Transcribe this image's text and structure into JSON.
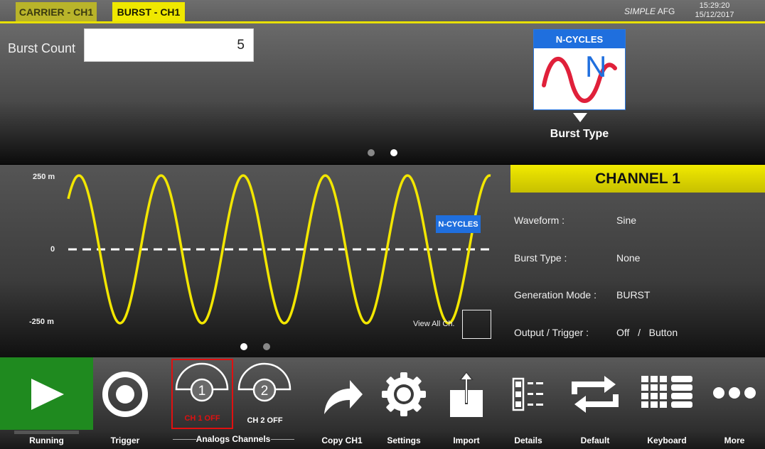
{
  "header": {
    "tab_carrier": "CARRIER - CH1",
    "tab_burst": "BURST - CH1",
    "brand_italic": "SIMPLE",
    "brand_rest": "AFG",
    "time": "15:29:20",
    "date": "15/12/2017"
  },
  "burst": {
    "count_label": "Burst Count",
    "count_value": "5",
    "type_badge": "N-CYCLES",
    "type_letter": "N",
    "type_caption": "Burst Type",
    "page_count": 2,
    "page_active": 2
  },
  "waveform": {
    "y_top_label": "250 m",
    "y_mid_label": "0",
    "y_bottom_label": "-250 m",
    "badge": "N-CYCLES",
    "view_all_label": "View All Ch.",
    "cycles": 5,
    "page_count": 2,
    "page_active": 1
  },
  "channel": {
    "title": "CHANNEL 1",
    "rows": [
      {
        "label": "Waveform :",
        "value": "Sine"
      },
      {
        "label": "Burst Type :",
        "value": "None"
      },
      {
        "label": "Generation Mode :",
        "value": "BURST"
      },
      {
        "label": "Output / Trigger :",
        "value": "Off   /   Button"
      }
    ]
  },
  "toolbar": {
    "running": "Running",
    "trigger": "Trigger",
    "ch1_num": "1",
    "ch1_state": "CH 1 OFF",
    "ch2_num": "2",
    "ch2_state": "CH 2 OFF",
    "analogs": "Analogs Channels",
    "copy": "Copy CH1",
    "settings": "Settings",
    "import": "Import",
    "details": "Details",
    "default": "Default",
    "keyboard": "Keyboard",
    "more": "More"
  },
  "colors": {
    "accent_yellow": "#efe800",
    "badge_blue": "#1f6fde",
    "running_green": "#1f8a1f",
    "wave_yellow": "#f2e600",
    "sine_red": "#e0203a",
    "alert_red": "#e01010"
  }
}
